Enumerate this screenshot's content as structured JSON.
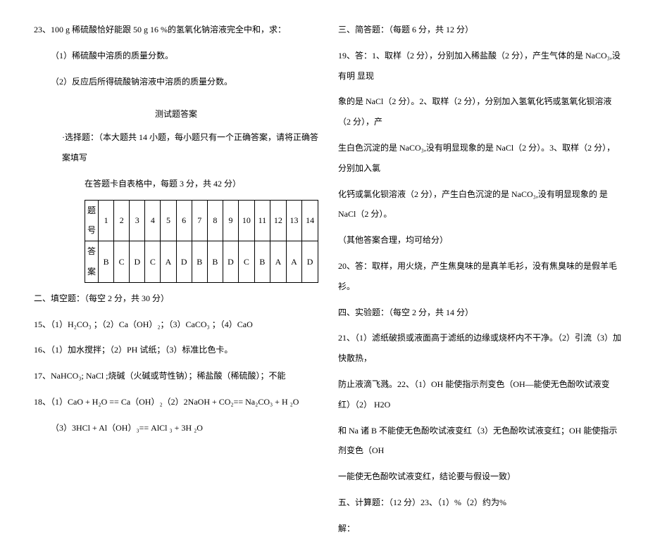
{
  "left": {
    "q23": "23、100 g 稀硫酸恰好能跟 50 g 16 %的氢氧化钠溶液完全中和，求：",
    "q23_1": "（1）稀硫酸中溶质的质量分数。",
    "q23_2": "（2）反应后所得硫酸钠溶液中溶质的质量分数。",
    "ans_title": "测试题答案",
    "sec1_inst": "·选择题：（本大题共 14 小题，每小题只有一个正确答案，请将正确答案填写",
    "sec1_inst2": "在答题卡自表格中，每题 3 分，共 42 分）",
    "row_head": "题号",
    "row_ans": "答案",
    "cols": [
      "1",
      "2",
      "3",
      "4",
      "5",
      "6",
      "7",
      "8",
      "9",
      "10",
      "11",
      "12",
      "13",
      "14"
    ],
    "answers": [
      "B",
      "C",
      "D",
      "C",
      "A",
      "D",
      "B",
      "B",
      "D",
      "C",
      "B",
      "A",
      "A",
      "D"
    ],
    "sec2": "二、填空题：（每空 2 分，共 30 分）",
    "a15": "15、（1）H₂CO₃ ；（2）Ca（OH）₂；（3）CaCO₃ ；（4）CaO",
    "a16": "16、（1）加水搅拌；（2）PH 试纸；（3）标准比色卡。",
    "a17": "17、NaHCO₃; NaCl ;烧碱（火碱或苛性钠）；稀盐酸（稀硫酸）；不能",
    "a18a": "18、（1）CaO + H₂O == Ca（OH）₂（2）2NaOH + CO₂== Na₂CO₃ + H ₂O",
    "a18b": "（3）3HCl + Al（OH）₃== AlCl ₃ + 3H ₂O"
  },
  "right": {
    "sec3": "三、简答题：（每题 6 分，共 12 分）",
    "a19a": "19、答：1、取样（2 分），分别加入稀盐酸（2 分），产生气体的是 NaCO₃,没有明 显现",
    "a19b": "象的是 NaCl（2 分）。2、取样（2 分），分别加入氢氧化钙或氢氧化钡溶液（2 分），产",
    "a19c": "生白色沉淀的是 NaCO₃,没有明显现象的是 NaCl（2 分）。3、取样（2 分）， 分别加入氯",
    "a19d": "化钙或氯化钡溶液（2 分），产生白色沉淀的是 NaCO₃,没有明显现象的 是 NaCl（2 分）。",
    "a19e": "（其他答案合理，均可给分）",
    "a20": "20、答：取样，用火烧，产生焦臭味的是真羊毛衫，没有焦臭味的是假羊毛衫。",
    "sec4": "四、实验题：（每空 2 分，共 14 分）",
    "a21a": "21、（1）滤纸破损或液面高于滤纸的边缘或烧杯内不干净。（2）引流（3）加快散热，",
    "a21b": "防止液滴飞溅。22、（1）OH 能使指示剂变色（OH—能使无色酚吹试液变红）（2） H2O",
    "a21c": "和 Na 诸 B 不能使无色酚吹试液变红（3）无色酚吹试液变红；OH 能使指示剂变色（OH",
    "a21d": "一能使无色酚吹试液变红，结论要与假设一致）",
    "sec5": "五、计算题：（12 分）23、（1）%（2）约为%",
    "solve": "解："
  }
}
